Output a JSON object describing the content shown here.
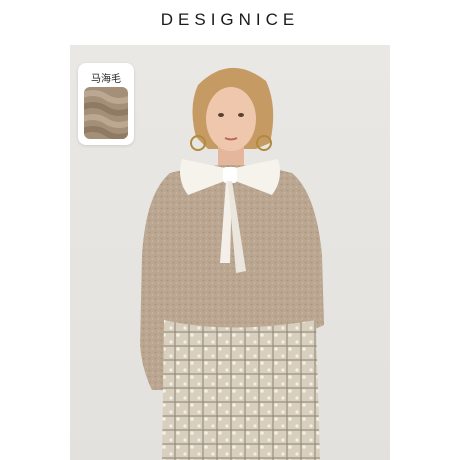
{
  "brand": {
    "name": "DESIGNICE"
  },
  "material_tag": {
    "label": "马海毛"
  },
  "colors": {
    "background": "#e9e7e4",
    "sweater": "#b9a58e",
    "bow": "#f5f2ec",
    "skirt": "#d2c8b6"
  },
  "icons": {
    "material_swatch": "mohair-swatch-icon"
  }
}
